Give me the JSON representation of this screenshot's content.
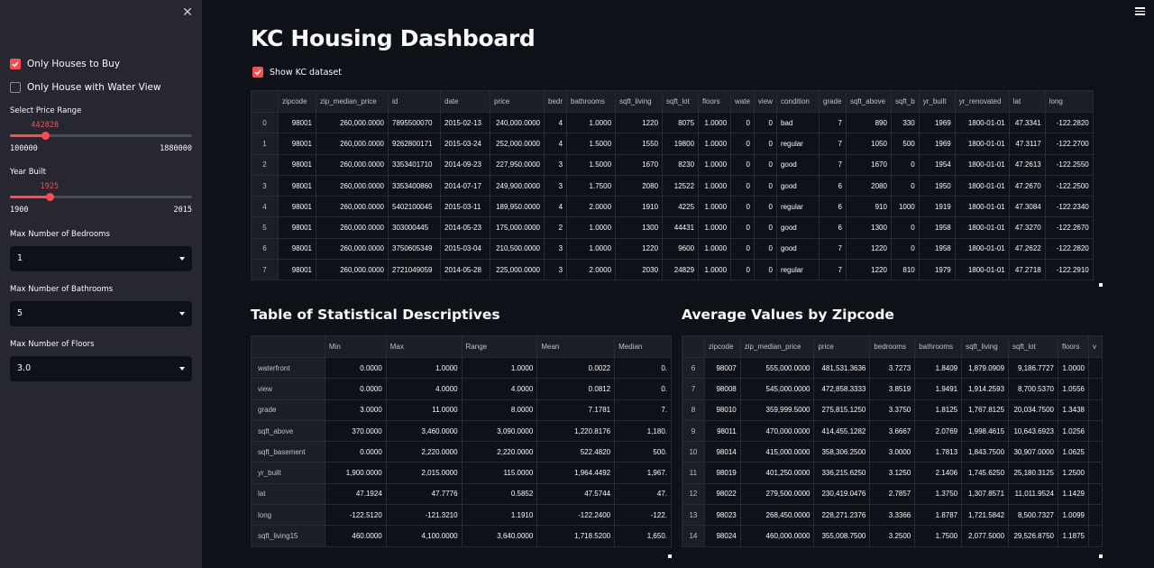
{
  "sidebar": {
    "close_icon": "close-icon",
    "checkbox_buy": {
      "label": "Only Houses to Buy",
      "checked": true
    },
    "checkbox_water": {
      "label": "Only House with Water View",
      "checked": false
    },
    "price_slider": {
      "label": "Select Price Range",
      "value": "442828",
      "min": "100000",
      "max": "1880000",
      "fraction": 0.192
    },
    "year_slider": {
      "label": "Year Built",
      "value": "1925",
      "min": "1900",
      "max": "2015",
      "fraction": 0.217
    },
    "bedrooms": {
      "label": "Max Number of Bedrooms",
      "value": "1"
    },
    "bathrooms": {
      "label": "Max Number of Bathrooms",
      "value": "5"
    },
    "floors": {
      "label": "Max Number of Floors",
      "value": "3.0"
    }
  },
  "main": {
    "title": "KC Housing Dashboard",
    "show_dataset": {
      "label": "Show KC dataset",
      "checked": true
    },
    "stats_title": "Table of Statistical Descriptives",
    "zip_title": "Average Values by Zipcode"
  },
  "colors": {
    "accent": "#ff4b4b",
    "sidebar_bg": "#262730",
    "main_bg": "#0e1117"
  },
  "dataset_table": {
    "columns": [
      "",
      "zipcode",
      "zip_median_price",
      "id",
      "date",
      "price",
      "bedr",
      "bathrooms",
      "sqft_living",
      "sqft_lot",
      "floors",
      "wate",
      "view",
      "condition",
      "grade",
      "sqft_above",
      "sqft_b",
      "yr_built",
      "yr_renovated",
      "lat",
      "long"
    ],
    "rows": [
      [
        "0",
        "98001",
        "260,000.0000",
        "7895500070",
        "2015-02-13",
        "240,000.0000",
        "4",
        "1.0000",
        "1220",
        "8075",
        "1.0000",
        "0",
        "0",
        "bad",
        "7",
        "890",
        "330",
        "1969",
        "1800-01-01",
        "47.3341",
        "-122.2820"
      ],
      [
        "1",
        "98001",
        "260,000.0000",
        "9262800171",
        "2015-03-24",
        "252,000.0000",
        "4",
        "1.5000",
        "1550",
        "19800",
        "1.0000",
        "0",
        "0",
        "regular",
        "7",
        "1050",
        "500",
        "1969",
        "1800-01-01",
        "47.3117",
        "-122.2700"
      ],
      [
        "2",
        "98001",
        "260,000.0000",
        "3353401710",
        "2014-09-23",
        "227,950.0000",
        "3",
        "1.5000",
        "1670",
        "8230",
        "1.0000",
        "0",
        "0",
        "good",
        "7",
        "1670",
        "0",
        "1954",
        "1800-01-01",
        "47.2613",
        "-122.2550"
      ],
      [
        "3",
        "98001",
        "260,000.0000",
        "3353400860",
        "2014-07-17",
        "249,900.0000",
        "3",
        "1.7500",
        "2080",
        "12522",
        "1.0000",
        "0",
        "0",
        "good",
        "6",
        "2080",
        "0",
        "1950",
        "1800-01-01",
        "47.2670",
        "-122.2500"
      ],
      [
        "4",
        "98001",
        "260,000.0000",
        "5402100045",
        "2015-03-11",
        "189,950.0000",
        "4",
        "2.0000",
        "1910",
        "4225",
        "1.0000",
        "0",
        "0",
        "regular",
        "6",
        "910",
        "1000",
        "1919",
        "1800-01-01",
        "47.3084",
        "-122.2340"
      ],
      [
        "5",
        "98001",
        "260,000.0000",
        "303000445",
        "2014-05-23",
        "175,000.0000",
        "2",
        "1.0000",
        "1300",
        "44431",
        "1.0000",
        "0",
        "0",
        "good",
        "6",
        "1300",
        "0",
        "1958",
        "1800-01-01",
        "47.3270",
        "-122.2670"
      ],
      [
        "6",
        "98001",
        "260,000.0000",
        "3750605349",
        "2015-03-04",
        "210,500.0000",
        "3",
        "1.0000",
        "1220",
        "9600",
        "1.0000",
        "0",
        "0",
        "good",
        "7",
        "1220",
        "0",
        "1958",
        "1800-01-01",
        "47.2622",
        "-122.2820"
      ],
      [
        "7",
        "98001",
        "260,000.0000",
        "2721049059",
        "2014-05-28",
        "225,000.0000",
        "3",
        "2.0000",
        "2030",
        "24829",
        "1.0000",
        "0",
        "0",
        "regular",
        "7",
        "1220",
        "810",
        "1979",
        "1800-01-01",
        "47.2718",
        "-122.2910"
      ]
    ]
  },
  "stats_table": {
    "columns": [
      "",
      "Min",
      "Max",
      "Range",
      "Mean",
      "Median"
    ],
    "rows": [
      [
        "waterfront",
        "0.0000",
        "1.0000",
        "1.0000",
        "0.0022",
        "0."
      ],
      [
        "view",
        "0.0000",
        "4.0000",
        "4.0000",
        "0.0812",
        "0."
      ],
      [
        "grade",
        "3.0000",
        "11.0000",
        "8.0000",
        "7.1781",
        "7."
      ],
      [
        "sqft_above",
        "370.0000",
        "3,460.0000",
        "3,090.0000",
        "1,220.8176",
        "1,180."
      ],
      [
        "sqft_basement",
        "0.0000",
        "2,220.0000",
        "2,220.0000",
        "522.4820",
        "500."
      ],
      [
        "yr_built",
        "1,900.0000",
        "2,015.0000",
        "115.0000",
        "1,964.4492",
        "1,967."
      ],
      [
        "lat",
        "47.1924",
        "47.7776",
        "0.5852",
        "47.5744",
        "47."
      ],
      [
        "long",
        "-122.5120",
        "-121.3210",
        "1.1910",
        "-122.2400",
        "-122."
      ],
      [
        "sqft_living15",
        "460.0000",
        "4,100.0000",
        "3,640.0000",
        "1,718.5200",
        "1,650."
      ]
    ]
  },
  "zip_table": {
    "columns": [
      "",
      "zipcode",
      "zip_median_price",
      "price",
      "bedrooms",
      "bathrooms",
      "sqft_living",
      "sqft_lot",
      "floors",
      "v"
    ],
    "rows": [
      [
        "6",
        "98007",
        "555,000.0000",
        "481,531.3636",
        "3.7273",
        "1.8409",
        "1,879.0909",
        "9,186.7727",
        "1.0000",
        ""
      ],
      [
        "7",
        "98008",
        "545,000.0000",
        "472,858.3333",
        "3.8519",
        "1.9491",
        "1,914.2593",
        "8,700.5370",
        "1.0556",
        ""
      ],
      [
        "8",
        "98010",
        "359,999.5000",
        "275,815.1250",
        "3.3750",
        "1.8125",
        "1,767.8125",
        "20,034.7500",
        "1.3438",
        ""
      ],
      [
        "9",
        "98011",
        "470,000.0000",
        "414,455.1282",
        "3.6667",
        "2.0769",
        "1,998.4615",
        "10,643.6923",
        "1.0256",
        ""
      ],
      [
        "10",
        "98014",
        "415,000.0000",
        "358,306.2500",
        "3.0000",
        "1.7813",
        "1,843.7500",
        "30,907.0000",
        "1.0625",
        ""
      ],
      [
        "11",
        "98019",
        "401,250.0000",
        "336,215.6250",
        "3.1250",
        "2.1406",
        "1,745.6250",
        "25,180.3125",
        "1.2500",
        ""
      ],
      [
        "12",
        "98022",
        "279,500.0000",
        "230,419.0476",
        "2.7857",
        "1.3750",
        "1,307.8571",
        "11,011.9524",
        "1.1429",
        ""
      ],
      [
        "13",
        "98023",
        "268,450.0000",
        "228,271.2376",
        "3.3366",
        "1.8787",
        "1,721.5842",
        "8,500.7327",
        "1.0099",
        ""
      ],
      [
        "14",
        "98024",
        "460,000.0000",
        "355,008.7500",
        "3.2500",
        "1.7500",
        "2,077.5000",
        "29,526.8750",
        "1.1875",
        ""
      ]
    ]
  }
}
